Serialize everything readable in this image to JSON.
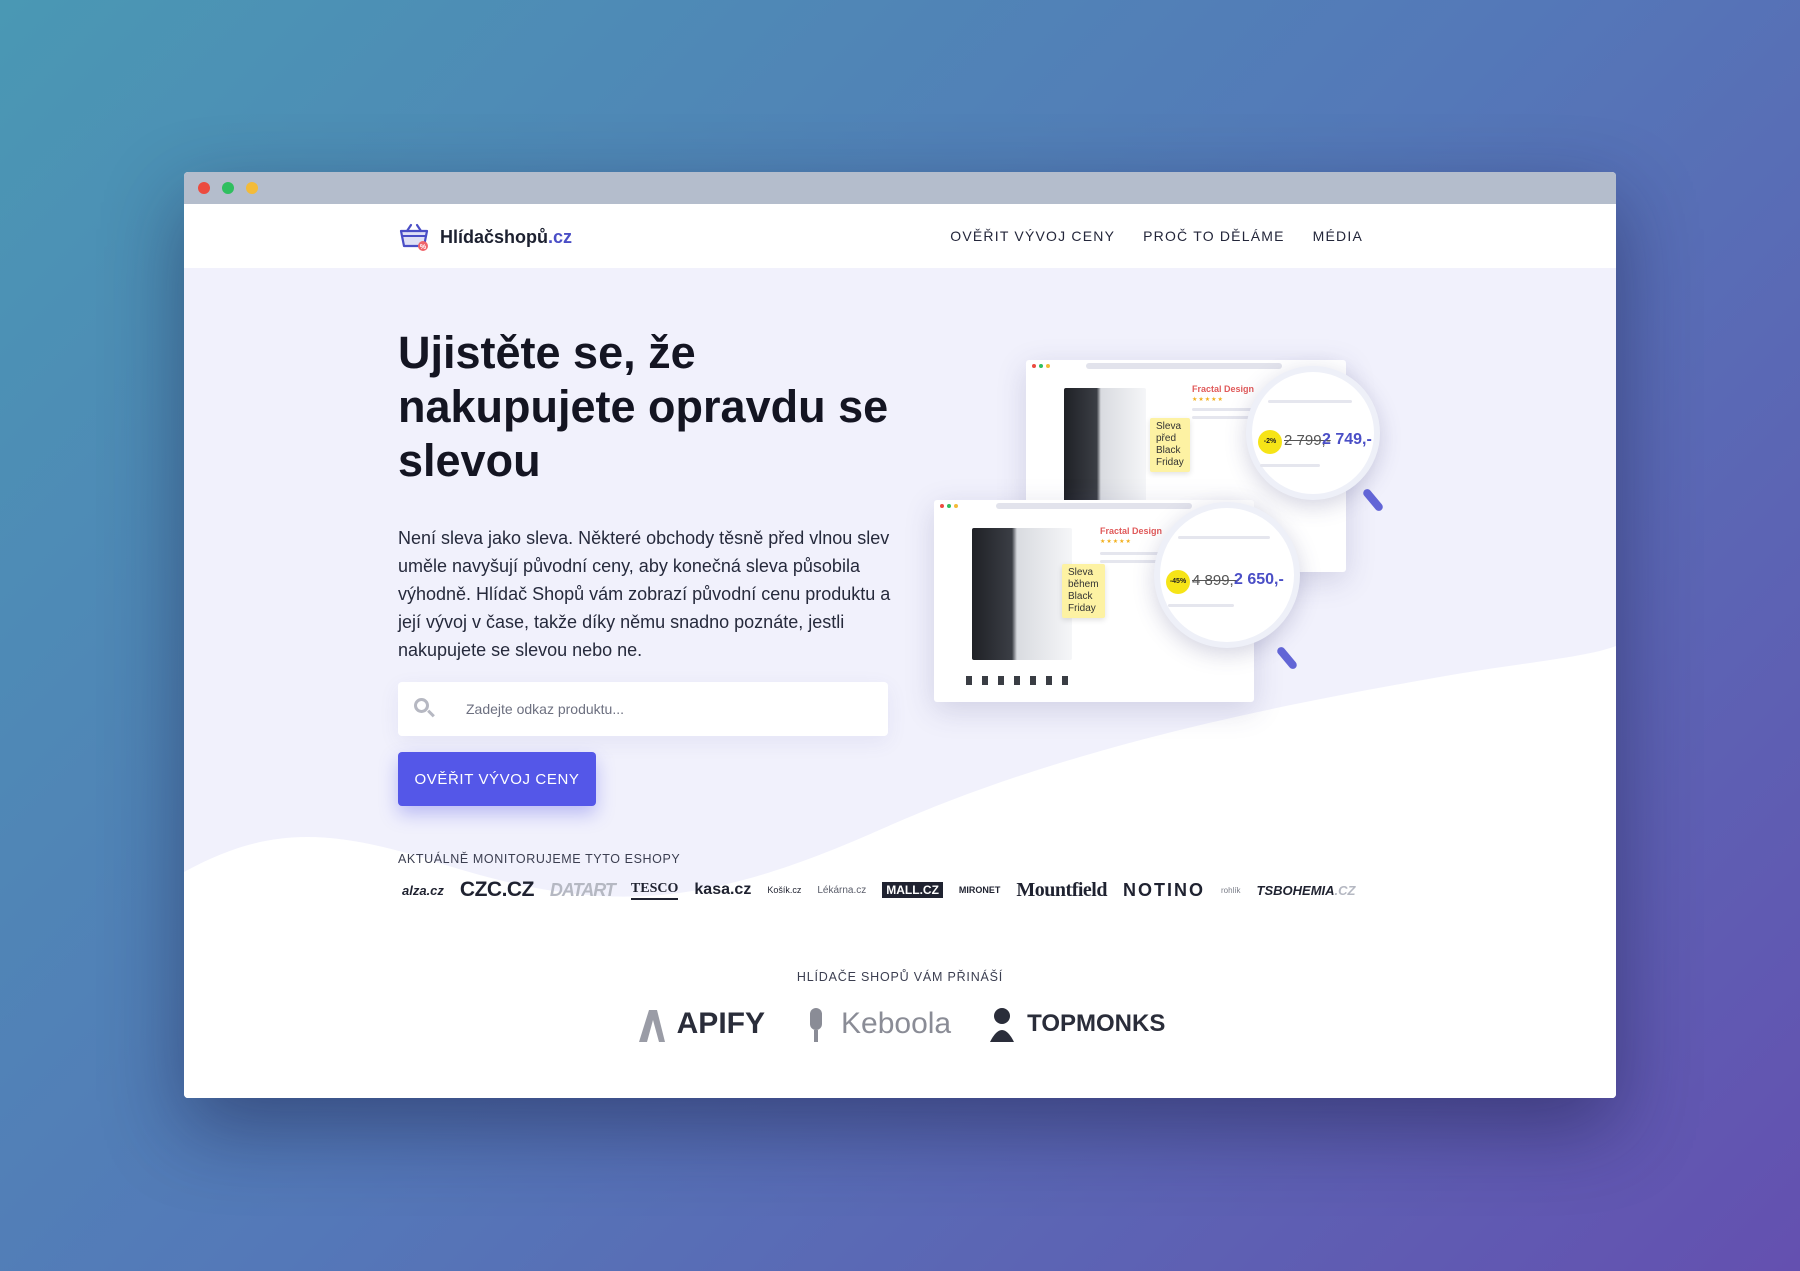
{
  "window": {
    "controls": [
      "close",
      "minimize",
      "zoom"
    ]
  },
  "header": {
    "logo": {
      "name": "Hlídačshopů",
      "tld": ".cz",
      "icon": "basket-icon"
    },
    "nav": [
      "OVĚŘIT VÝVOJ CENY",
      "PROČ TO DĚLÁME",
      "MÉDIA"
    ]
  },
  "hero": {
    "headline": "Ujistěte se, že nakupujete opravdu se slevou",
    "lead": "Není sleva jako sleva. Některé obchody těsně před vlnou slev uměle navyšují původní ceny, aby konečná sleva působila výhodně. Hlídač Shopů vám zobrazí původní cenu produktu a její vývoj v čase, takže díky němu snadno poznáte, jestli nakupujete se slevou nebo ne.",
    "search": {
      "placeholder": "Zadejte odkaz produktu...",
      "value": "",
      "icon": "search-icon"
    },
    "cta": "OVĚŘIT VÝVOJ CENY"
  },
  "eshops": {
    "label": "AKTUÁLNĚ MONITORUJEME TYTO ESHOPY",
    "logos": [
      "alza.cz",
      "CZC.CZ",
      "DATART",
      "TESCO",
      "kasa.cz",
      "Košík.cz",
      "Lékárna.cz",
      "MALL.CZ",
      "MIRONET",
      "Mountfield",
      "NOTINO",
      "rohlík",
      "TSBOHEMIA",
      ".CZ"
    ]
  },
  "illustration": {
    "back": {
      "brand": "Fractal Design",
      "tag_line1": "Sleva před",
      "tag_line2": "Black Friday",
      "discount": "-2%",
      "old_price": "2 799,-",
      "new_price": "2 749,-"
    },
    "front": {
      "brand": "Fractal Design",
      "tag_line1": "Sleva během",
      "tag_line2": "Black Friday",
      "discount": "-45%",
      "old_price": "4 899,-",
      "new_price": "2 650,-"
    }
  },
  "partners": {
    "label": "HLÍDAČE SHOPŮ VÁM PŘINÁŠÍ",
    "logos": [
      "APIFY",
      "Keboola",
      "TOPMONKS"
    ]
  },
  "colors": {
    "accent": "#5457e8",
    "brand_tld": "#4a4ec6",
    "hero_bg": "#f1f1fc",
    "tag_yellow": "#fdf2a3",
    "discount_yellow": "#f6e417"
  }
}
